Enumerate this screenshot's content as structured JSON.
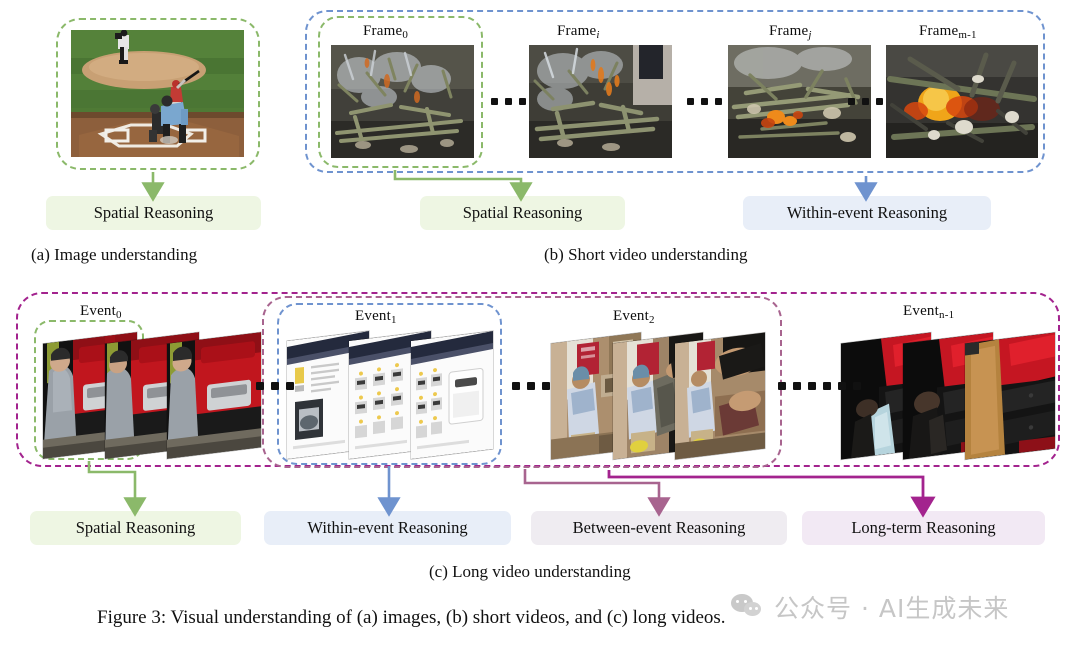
{
  "figure": {
    "caption": "Figure 3: Visual understanding of (a) images, (b) short videos, and (c) long videos."
  },
  "panels": {
    "a": {
      "caption": "(a) Image understanding",
      "image_alt": "baseball-batter-pitcher-scene",
      "reasoning": {
        "label": "Spatial Reasoning",
        "color": "#eef6e3",
        "arrow_color": "#8bb96a"
      }
    },
    "b": {
      "caption": "(b) Short video understanding",
      "frames": [
        {
          "label_prefix": "Frame",
          "label_sub": "0",
          "alt": "campfire-smoke-sticks-frame-0"
        },
        {
          "label_prefix": "Frame",
          "label_sub": "i",
          "alt": "campfire-smoke-sticks-frame-i"
        },
        {
          "label_prefix": "Frame",
          "label_sub": "j",
          "alt": "campfire-embers-sticks-frame-j"
        },
        {
          "label_prefix": "Frame",
          "label_sub": "m-1",
          "alt": "campfire-flames-sticks-frame-m-1"
        }
      ],
      "ellipses": [
        "...",
        "...",
        "..."
      ],
      "reasonings": [
        {
          "label": "Spatial Reasoning",
          "color": "#eef6e3",
          "arrow_color": "#8bb96a"
        },
        {
          "label": "Within-event Reasoning",
          "color": "#e8eef8",
          "arrow_color": "#6f93cf"
        }
      ],
      "box_colors": {
        "inner_green": "#8bb96a",
        "outer_blue": "#6f93cf"
      }
    },
    "c": {
      "caption": "(c) Long video understanding",
      "events": [
        {
          "label_prefix": "Event",
          "label_sub": "0",
          "alt": "man-beside-red-truck-clip"
        },
        {
          "label_prefix": "Event",
          "label_sub": "1",
          "alt": "laptop-screen-webpage-clip"
        },
        {
          "label_prefix": "Event",
          "label_sub": "2",
          "alt": "person-handling-fabric-indoors-clip"
        },
        {
          "label_prefix": "Event",
          "label_sub": "n-1",
          "alt": "red-theatre-seats-person-clip"
        }
      ],
      "ellipses": [
        "...",
        "...",
        "......",
        "......"
      ],
      "reasonings": [
        {
          "label": "Spatial Reasoning",
          "color": "#eef6e3",
          "arrow_color": "#8bb96a"
        },
        {
          "label": "Within-event Reasoning",
          "color": "#e8eef8",
          "arrow_color": "#6f93cf"
        },
        {
          "label": "Between-event Reasoning",
          "color": "#efecf1",
          "arrow_color": "#a8648f"
        },
        {
          "label": "Long-term Reasoning",
          "color": "#f2e9f4",
          "arrow_color": "#a3238e"
        }
      ],
      "box_colors": {
        "inner_green": "#8bb96a",
        "inner_blue": "#6f93cf",
        "inner_mauve": "#a8648f",
        "outer_purple": "#a3238e"
      }
    }
  },
  "watermark": {
    "text": "公众号 · AI生成未来",
    "color": "#c6c6c6",
    "icon": "wechat-icon"
  }
}
